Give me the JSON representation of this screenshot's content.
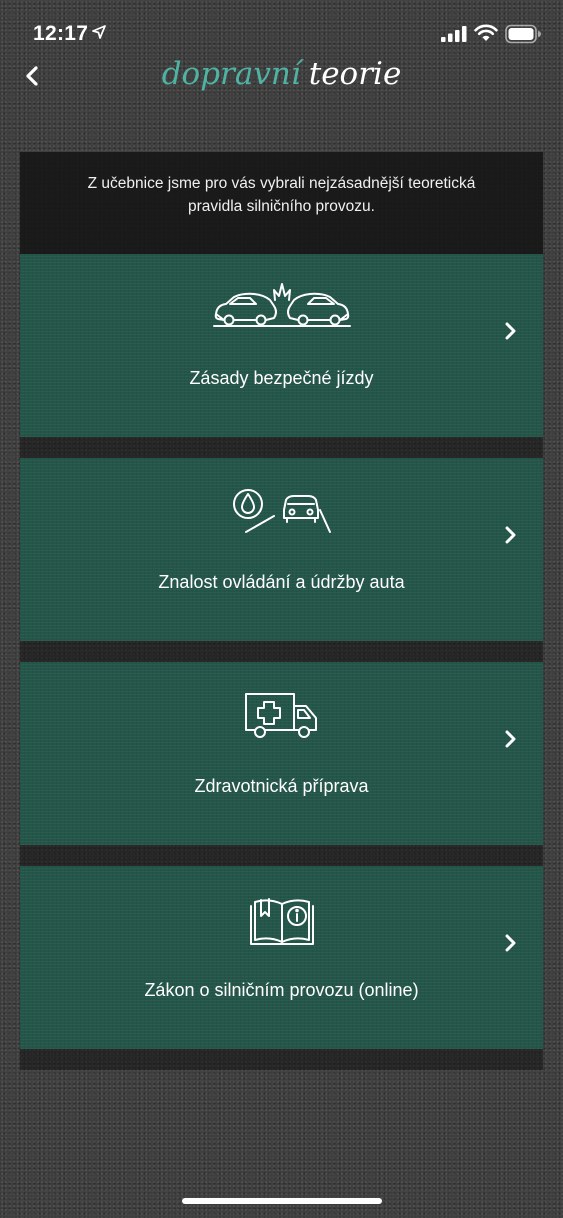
{
  "status_bar": {
    "time": "12:17",
    "icons": [
      "location-arrow-icon",
      "cellular-signal-icon",
      "wifi-icon",
      "battery-icon"
    ]
  },
  "header": {
    "back_icon": "chevron-left-icon",
    "title_part1": "dopravní",
    "title_part2": "teorie"
  },
  "intro": {
    "text": "Z učebnice jsme pro vás vybrali nejzásadnější teoretická pravidla silničního provozu."
  },
  "menu": {
    "items": [
      {
        "label": "Zásady bezpečné jízdy",
        "icon": "car-crash-icon"
      },
      {
        "label": "Znalost ovládání a údržby auta",
        "icon": "car-maintenance-icon"
      },
      {
        "label": "Zdravotnická příprava",
        "icon": "ambulance-icon"
      },
      {
        "label": "Zákon o silničním provozu (online)",
        "icon": "law-book-icon"
      }
    ],
    "chevron_icon": "chevron-right-icon"
  },
  "colors": {
    "accent": "#4fb3a3",
    "card_background": "#245549",
    "background": "#3d3d3d"
  }
}
